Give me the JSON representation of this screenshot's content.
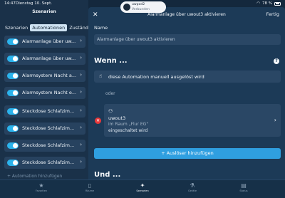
{
  "statusbar": {
    "time": "14:47",
    "date": "Dienstag 10. Sept.",
    "battery": "78 %"
  },
  "toast": {
    "device": "uwpod2",
    "status": "Verbunden"
  },
  "left": {
    "title": "Szenarien",
    "segments": [
      "Szenarien",
      "Automationen",
      "Zustände"
    ],
    "active_segment": "Automationen",
    "items": [
      {
        "label": "Alarmanlage über uw...",
        "enabled": true
      },
      {
        "label": "Alarmanlage über uw...",
        "enabled": true
      },
      {
        "label": "Alarmsystem Nacht a...",
        "enabled": true
      },
      {
        "label": "Alarmsystem Nacht e...",
        "enabled": true
      },
      {
        "label": "Steckdose Schlafzim...",
        "enabled": true
      },
      {
        "label": "Steckdose Schlafzim...",
        "enabled": true
      },
      {
        "label": "Steckdose Schlafzim...",
        "enabled": true
      },
      {
        "label": "Steckdose Schlafzim...",
        "enabled": true
      }
    ],
    "add_label": "+ Automation hinzufügen"
  },
  "sheet": {
    "title": "Alarmanlage über uwout3 aktivieren",
    "done_label": "Fertig",
    "name_label": "Name",
    "name_value": "Alarmanlage über uwout3 aktivieren",
    "when_heading": "Wenn ...",
    "trigger1_text": "diese Automation manuell ausgelöst wird",
    "or_label": "oder",
    "trigger2": {
      "device": "uwout3",
      "room": "im Raum „Flur EG\"",
      "state": "eingeschaltet wird"
    },
    "add_trigger_label": "+ Auslöser hinzufügen",
    "and_heading": "Und ..."
  },
  "tabs": [
    {
      "label": "Favoriten",
      "icon": "star-icon",
      "active": false
    },
    {
      "label": "Räume",
      "icon": "room-icon",
      "active": false
    },
    {
      "label": "Szenarien",
      "icon": "wand-icon",
      "active": true
    },
    {
      "label": "Geräte",
      "icon": "device-icon",
      "active": false
    },
    {
      "label": "Status",
      "icon": "status-icon",
      "active": false
    }
  ],
  "colors": {
    "accent": "#2f9fe0",
    "toggle_on": "#2bb3ec",
    "remove": "#e6393b"
  }
}
